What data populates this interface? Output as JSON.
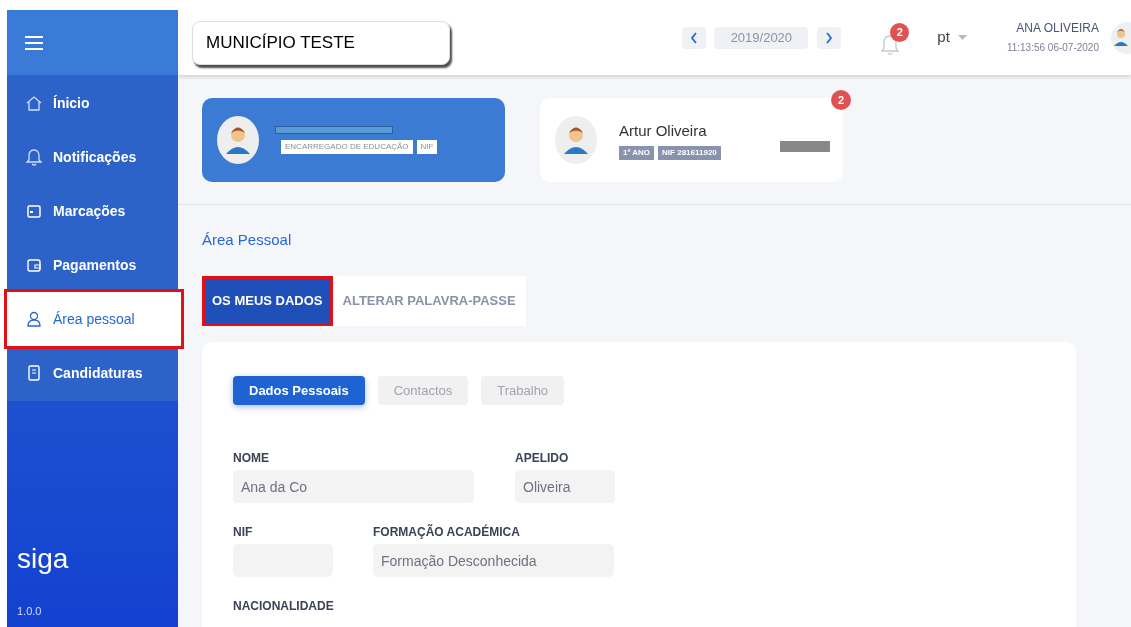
{
  "sidebar": {
    "items": [
      {
        "label": "Ínicio",
        "selected": false
      },
      {
        "label": "Notificações",
        "selected": false
      },
      {
        "label": "Marcações",
        "selected": false
      },
      {
        "label": "Pagamentos",
        "selected": false
      },
      {
        "label": "Área pessoal",
        "selected": true
      },
      {
        "label": "Candidaturas",
        "selected": false
      }
    ],
    "logo": "siga",
    "version": "1.0.0"
  },
  "header": {
    "municipality": "MUNICÍPIO TESTE",
    "school_year": "2019/2020",
    "notification_count": "2",
    "language": "pt",
    "user_name": "ANA OLIVEIRA",
    "timestamp": "11:13:56 06-07-2020"
  },
  "profiles": [
    {
      "kind": "guardian",
      "selected": true,
      "tags": [
        "ENCARREGADO DE EDUCAÇÃO",
        "NIF"
      ]
    },
    {
      "kind": "student",
      "selected": false,
      "name": "Artur Oliveira",
      "tags": [
        "1º ANO",
        "NIF 281611920"
      ],
      "badge": "2"
    }
  ],
  "section_title": "Área Pessoal",
  "tabs": [
    {
      "label": "OS MEUS DADOS",
      "selected": true
    },
    {
      "label": "ALTERAR PALAVRA-PASSE",
      "selected": false
    }
  ],
  "subtabs": [
    {
      "label": "Dados Pessoais",
      "selected": true
    },
    {
      "label": "Contactos",
      "selected": false
    },
    {
      "label": "Trabalho",
      "selected": false
    }
  ],
  "form_rows": [
    [
      {
        "kind": "input",
        "label": "NOME",
        "value": "Ana da Co"
      },
      {
        "kind": "input",
        "label": "APELIDO",
        "value": "Oliveira"
      }
    ],
    [
      {
        "kind": "input",
        "label": "NIF"
      },
      {
        "kind": "input",
        "label": "FORMAÇÃO ACADÉMICA",
        "value": "Formação Desconhecida"
      }
    ],
    [
      {
        "kind": "label",
        "label": "NACIONALIDADE"
      }
    ]
  ]
}
